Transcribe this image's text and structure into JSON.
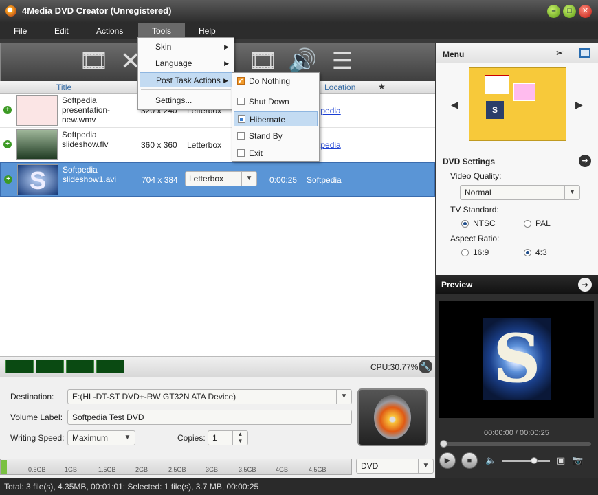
{
  "window": {
    "title": "4Media DVD Creator (Unregistered)"
  },
  "menubar": [
    "File",
    "Edit",
    "Actions",
    "Tools",
    "Help"
  ],
  "tools_menu": {
    "items": [
      "Skin",
      "Language",
      "Post Task Actions",
      "Settings..."
    ],
    "submenu": [
      "Do Nothing",
      "Shut Down",
      "Hibernate",
      "Stand By",
      "Exit"
    ]
  },
  "list": {
    "headers": {
      "title": "Title",
      "location": "Location",
      "star": "★"
    },
    "rows": [
      {
        "name": "Softpedia presentation-new.wmv",
        "res": "320 x 240",
        "aspect": "Letterbox",
        "duration": "",
        "location": "Softpedia"
      },
      {
        "name": "Softpedia slideshow.flv",
        "res": "360 x 360",
        "aspect": "Letterbox",
        "duration": "",
        "location": "Softpedia"
      },
      {
        "name": "Softpedia slideshow1.avi",
        "res": "704 x 384",
        "aspect": "Letterbox",
        "duration": "0:00:25",
        "location": "Softpedia"
      }
    ]
  },
  "cpu": "CPU:30.77%",
  "destination": {
    "label": "Destination:",
    "value": "E:(HL-DT-ST DVD+-RW GT32N ATA Device)"
  },
  "volume": {
    "label": "Volume Label:",
    "value": "Softpedia Test DVD"
  },
  "writing_speed": {
    "label": "Writing Speed:",
    "value": "Maximum"
  },
  "copies": {
    "label": "Copies:",
    "value": "1"
  },
  "capacity_ticks": [
    "0.5GB",
    "1GB",
    "1.5GB",
    "2GB",
    "2.5GB",
    "3GB",
    "3.5GB",
    "4GB",
    "4.5GB"
  ],
  "disc_type": "DVD",
  "status": "Total: 3 file(s), 4.35MB, 00:01:01; Selected: 1 file(s), 3.7 MB, 00:00:25",
  "right_menu": {
    "title": "Menu"
  },
  "dvd_settings": {
    "title": "DVD Settings",
    "quality_label": "Video Quality:",
    "quality_value": "Normal",
    "standard_label": "TV Standard:",
    "standard_options": [
      "NTSC",
      "PAL"
    ],
    "aspect_label": "Aspect Ratio:",
    "aspect_options": [
      "16:9",
      "4:3"
    ]
  },
  "preview": {
    "title": "Preview",
    "timecode": "00:00:00 / 00:00:25"
  }
}
